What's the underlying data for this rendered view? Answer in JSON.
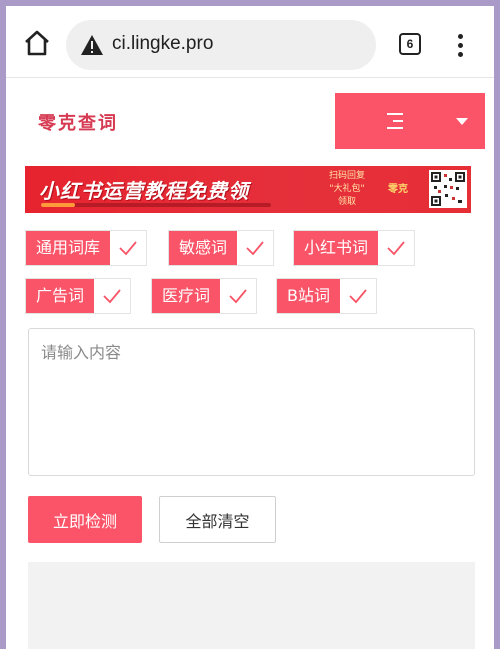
{
  "browser": {
    "url": "ci.lingke.pro",
    "tab_count": "6"
  },
  "site": {
    "logo": "零克查词"
  },
  "banner": {
    "title": "小红书运营教程免费领",
    "cta_lines": [
      "扫码回复",
      "\"大礼包\"",
      "领取"
    ],
    "brand": "零克"
  },
  "chips": [
    {
      "label": "通用词库",
      "checked": true
    },
    {
      "label": "敏感词",
      "checked": true
    },
    {
      "label": "小红书词",
      "checked": true
    },
    {
      "label": "广告词",
      "checked": true
    },
    {
      "label": "医疗词",
      "checked": true
    },
    {
      "label": "B站词",
      "checked": true
    }
  ],
  "input": {
    "placeholder": "请输入内容",
    "value": ""
  },
  "actions": {
    "detect_label": "立即检测",
    "clear_label": "全部清空"
  },
  "colors": {
    "accent": "#fb5468",
    "banner_red": "#e6232f",
    "logo": "#d63a52"
  }
}
